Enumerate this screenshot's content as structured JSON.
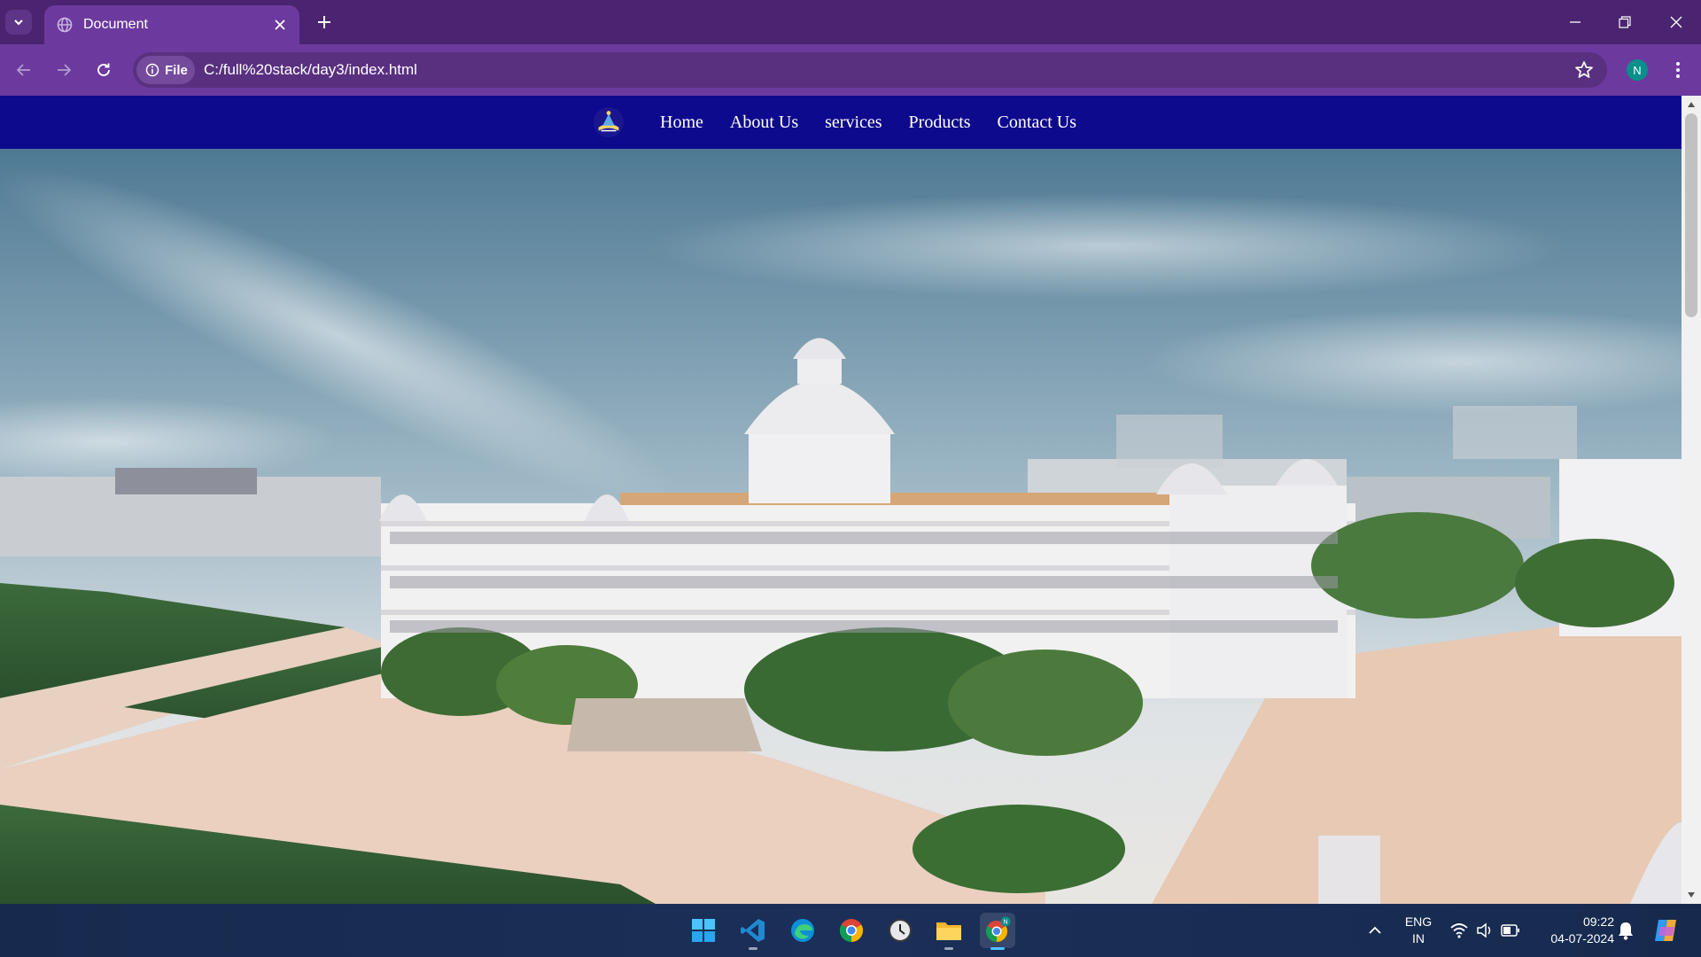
{
  "browser": {
    "tab_title": "Document",
    "url": "C:/full%20stack/day3/index.html",
    "security_chip": "File",
    "profile_initial": "N"
  },
  "site": {
    "nav": [
      "Home",
      "About Us",
      "services",
      "Products",
      "Contact Us"
    ]
  },
  "taskbar": {
    "lang_line1": "ENG",
    "lang_line2": "IN",
    "time": "09:22",
    "date": "04-07-2024"
  },
  "colors": {
    "tabstrip": "#4a2470",
    "toolbar": "#6c3a9e",
    "site_nav": "#0e0a8e",
    "taskbar": "#1b2f58"
  }
}
